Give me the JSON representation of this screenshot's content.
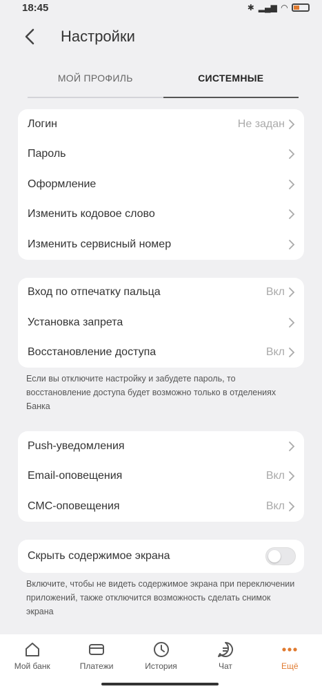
{
  "status": {
    "time": "18:45"
  },
  "header": {
    "title": "Настройки"
  },
  "tabs": [
    {
      "label": "МОЙ ПРОФИЛЬ",
      "active": false
    },
    {
      "label": "СИСТЕМНЫЕ",
      "active": true
    }
  ],
  "group1": [
    {
      "label": "Логин",
      "value": "Не задан"
    },
    {
      "label": "Пароль",
      "value": ""
    },
    {
      "label": "Оформление",
      "value": ""
    },
    {
      "label": "Изменить кодовое слово",
      "value": ""
    },
    {
      "label": "Изменить сервисный номер",
      "value": ""
    }
  ],
  "group2": [
    {
      "label": "Вход по отпечатку пальца",
      "value": "Вкл"
    },
    {
      "label": "Установка запрета",
      "value": ""
    },
    {
      "label": "Восстановление доступа",
      "value": "Вкл"
    }
  ],
  "group2_note": "Если вы отключите настройку и забудете пароль, то восстановление доступа будет возможно только в отделениях Банка",
  "group3": [
    {
      "label": "Push-уведомления",
      "value": ""
    },
    {
      "label": "Email-оповещения",
      "value": "Вкл"
    },
    {
      "label": "СМС-оповещения",
      "value": "Вкл"
    }
  ],
  "group4": {
    "label": "Скрыть содержимое экрана",
    "toggle_on": false,
    "note": "Включите, чтобы не видеть содержимое экрана при переключении приложений, также отключится возможность сделать снимок экрана"
  },
  "bottom_nav": [
    {
      "label": "Мой банк",
      "icon": "home-icon"
    },
    {
      "label": "Платежи",
      "icon": "card-icon"
    },
    {
      "label": "История",
      "icon": "clock-icon"
    },
    {
      "label": "Чат",
      "icon": "chat-icon"
    },
    {
      "label": "Ещё",
      "icon": "more-icon",
      "active": true
    }
  ],
  "colors": {
    "accent": "#e07a2f",
    "background": "#f0f0f2",
    "card": "#ffffff"
  }
}
